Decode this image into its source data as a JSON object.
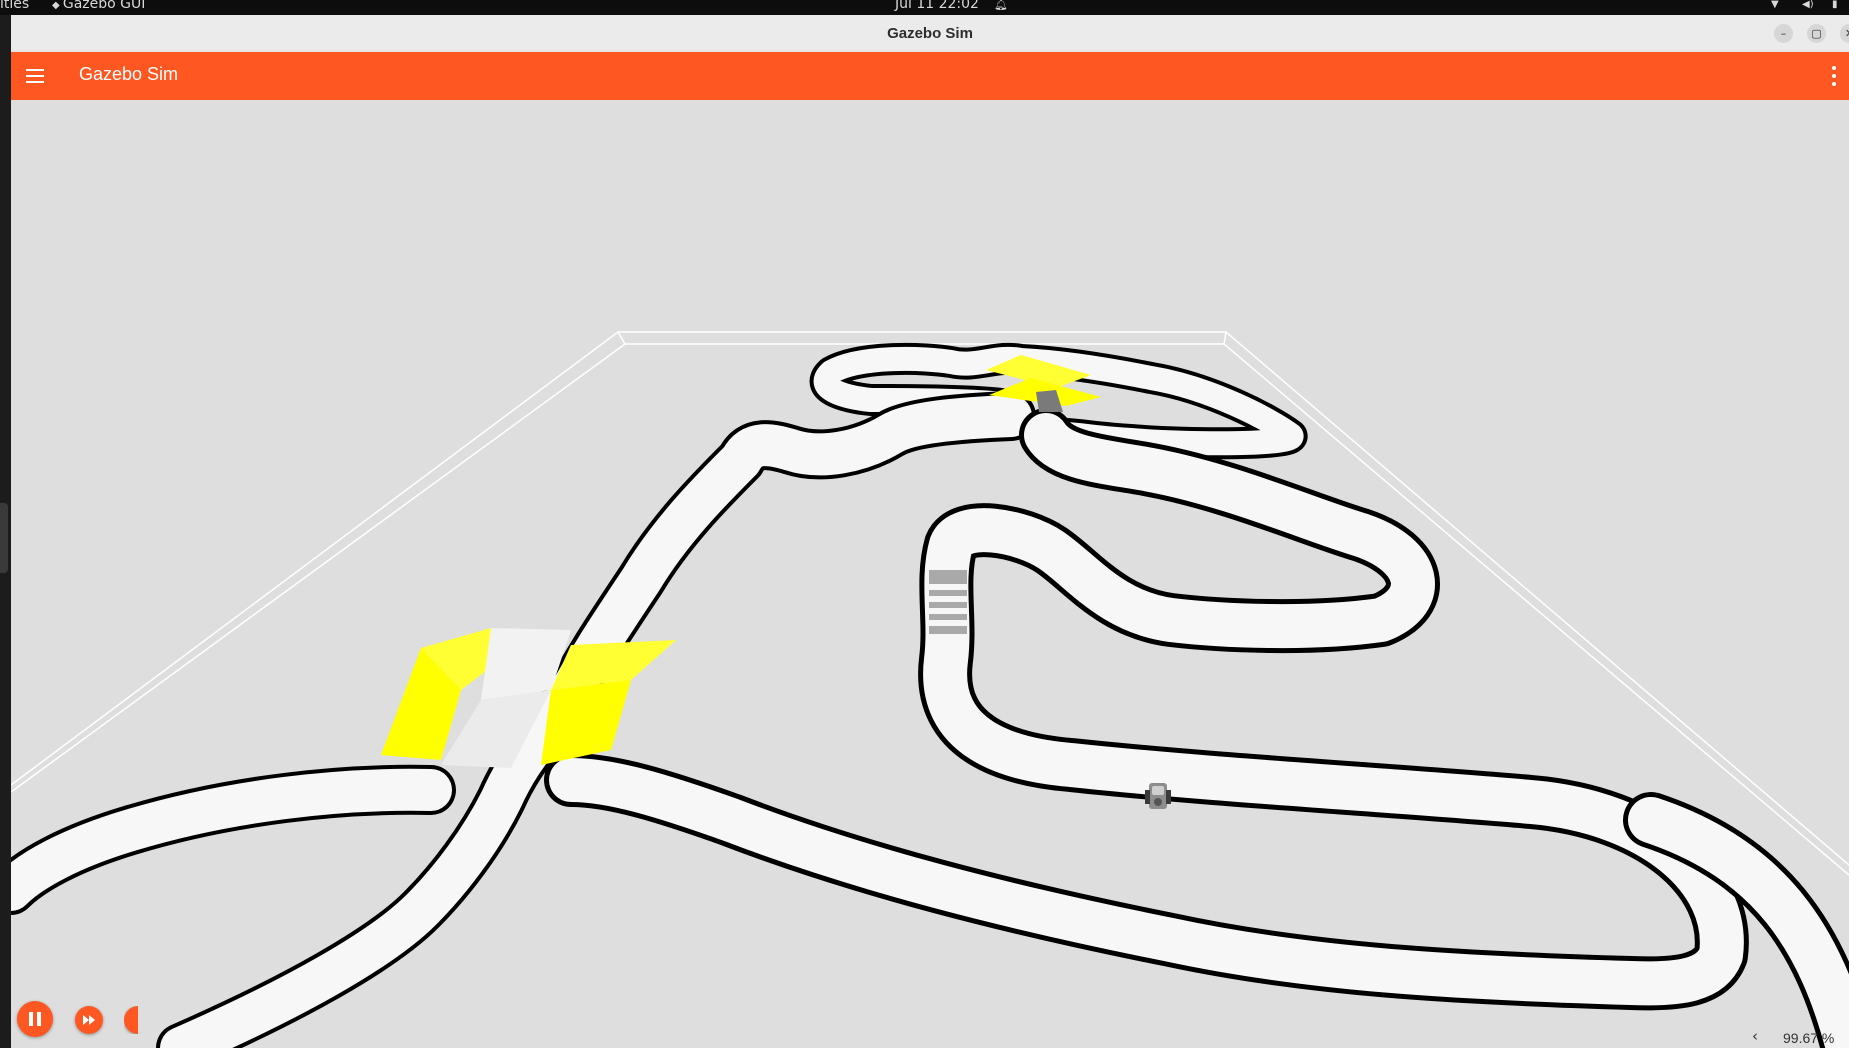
{
  "top_bar": {
    "activities": "ities",
    "app_menu": "Gazebo GUI",
    "clock": "Jul 11  22:02"
  },
  "window": {
    "title": "Gazebo Sim",
    "buttons": [
      "minimize",
      "maximize",
      "close"
    ]
  },
  "app_bar": {
    "title": "Gazebo Sim",
    "menu_icon": "hamburger-menu-icon",
    "overflow_icon": "more-vert-icon"
  },
  "sim_controls": {
    "play_pause_icon": "pause-icon",
    "step_icon": "fast-forward-icon"
  },
  "stats": {
    "toggle": "‹",
    "rtf": "99.67 %"
  },
  "colors": {
    "accent": "#ff5722",
    "ground": "#dedede",
    "track": "#f7f7f7",
    "track_edge": "#000000",
    "ramp": "#ffff00"
  }
}
